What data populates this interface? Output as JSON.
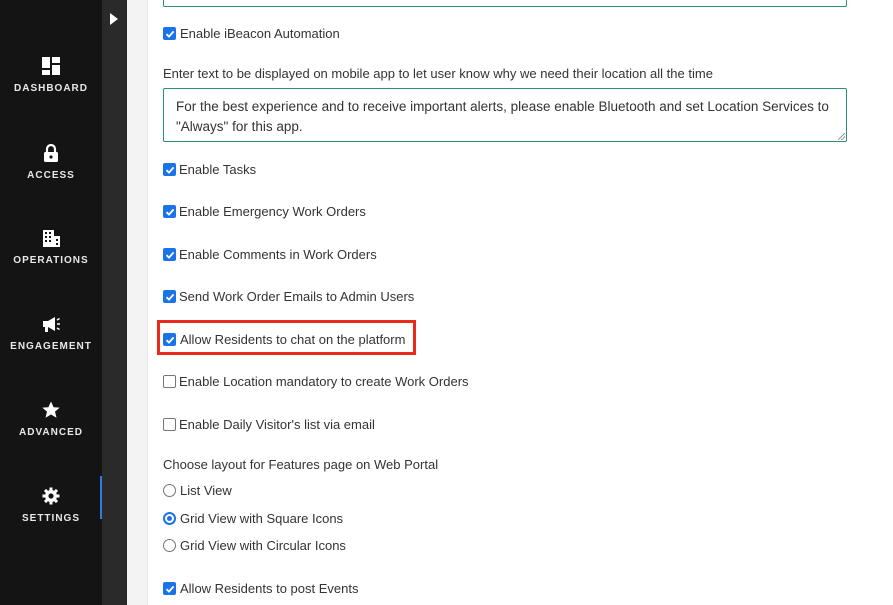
{
  "sidebar": {
    "items": [
      {
        "label": "DASHBOARD",
        "icon": "dashboard-icon"
      },
      {
        "label": "ACCESS",
        "icon": "lock-icon"
      },
      {
        "label": "OPERATIONS",
        "icon": "building-icon"
      },
      {
        "label": "ENGAGEMENT",
        "icon": "megaphone-icon"
      },
      {
        "label": "ADVANCED",
        "icon": "star-icon"
      },
      {
        "label": "SETTINGS",
        "icon": "gear-icon",
        "active": true
      }
    ],
    "toggle_icon": "caret-right-icon",
    "accent_color": "#2f7be0"
  },
  "settings": {
    "ibeacon": {
      "label": "Enable iBeacon Automation",
      "checked": true
    },
    "location_prompt_label": "Enter text to be displayed on mobile app to let user know why we need their location all the time",
    "location_prompt_value": "For the best experience and to receive important alerts, please enable Bluetooth and set Location Services to \"Always\" for this app.",
    "enable_tasks": {
      "label": "Enable Tasks",
      "checked": true
    },
    "emergency_work_orders": {
      "label": "Enable Emergency Work Orders",
      "checked": true
    },
    "comments_work_orders": {
      "label": "Enable Comments in Work Orders",
      "checked": true
    },
    "work_order_emails": {
      "label": "Send Work Order Emails to Admin Users",
      "checked": true
    },
    "residents_chat": {
      "label": "Allow Residents to chat on the platform",
      "checked": true
    },
    "location_mandatory": {
      "label": "Enable Location mandatory to create Work Orders",
      "checked": false
    },
    "daily_visitors": {
      "label": "Enable Daily Visitor's list via email",
      "checked": false
    },
    "layout_label": "Choose layout for Features page on Web Portal",
    "layout_options": [
      {
        "label": "List View",
        "selected": false
      },
      {
        "label": "Grid View with Square Icons",
        "selected": true
      },
      {
        "label": "Grid View with Circular Icons",
        "selected": false
      }
    ],
    "residents_events": {
      "label": "Allow Residents to post Events",
      "checked": true
    }
  },
  "colors": {
    "checkbox": "#1a73e8",
    "highlight": "#e8291c",
    "textarea_border": "#2d8c7a"
  }
}
